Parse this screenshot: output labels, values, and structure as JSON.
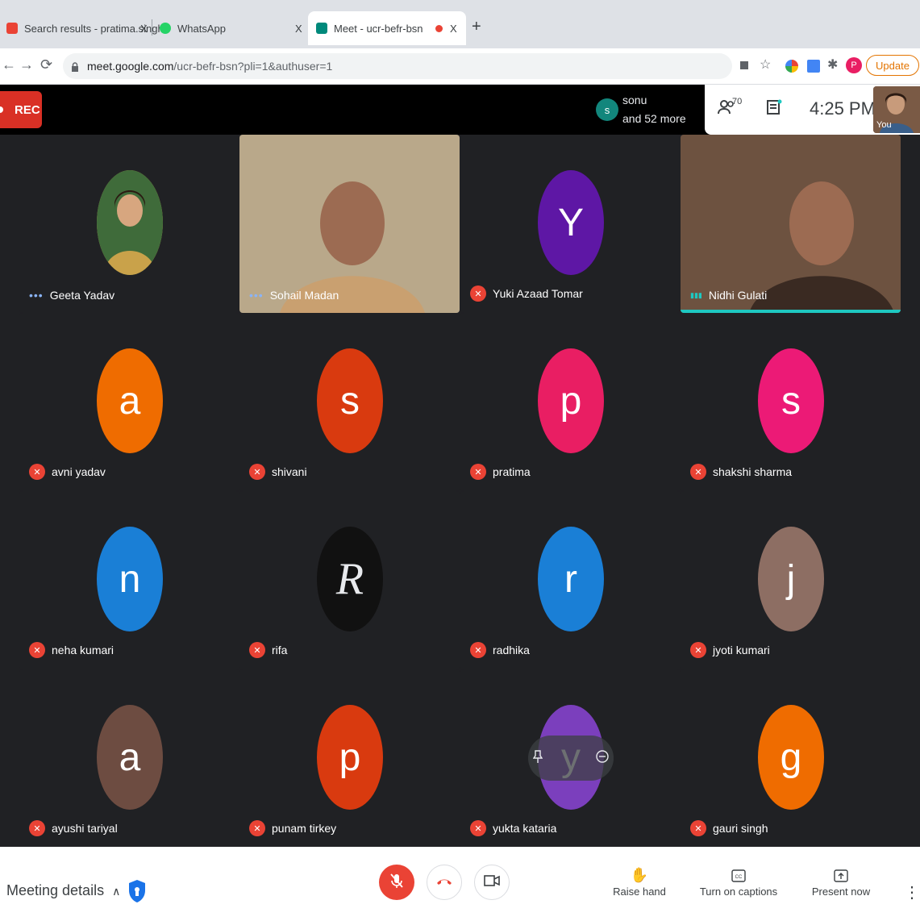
{
  "browser": {
    "tabs": [
      {
        "title": "Search results - pratima.singh",
        "close": "X",
        "favicon_color": "#ea4335"
      },
      {
        "title": "WhatsApp",
        "close": "X",
        "favicon_color": "#25d366"
      },
      {
        "title": "Meet - ucr-befr-bsn",
        "close": "X",
        "favicon_color": "#00897b"
      }
    ],
    "new_tab": "+",
    "url_host": "meet.google.com",
    "url_path": "/ucr-befr-bsn?pli=1&authuser=1",
    "update_label": "Update",
    "profile_initial": "P"
  },
  "meet": {
    "rec_label": "REC",
    "presenter": {
      "initial": "s",
      "name": "sonu",
      "more": "and 52 more"
    },
    "people_count": "70",
    "time": "4:25 PM",
    "self_label": "You",
    "tiles": [
      {
        "name": "Geeta Yadav",
        "type": "photo",
        "status": "dots",
        "color": "#c9a24a"
      },
      {
        "name": "Sohail Madan",
        "type": "video",
        "status": "dots",
        "color": "#b9a88a"
      },
      {
        "name": "Yuki Azaad Tomar",
        "type": "letter",
        "letter": "Y",
        "status": "muted",
        "color": "#5e17a5"
      },
      {
        "name": "Nidhi Gulati",
        "type": "video",
        "status": "speaking",
        "color": "#6d5240"
      },
      {
        "name": "avni yadav",
        "type": "letter",
        "letter": "a",
        "status": "muted",
        "color": "#ef6c00"
      },
      {
        "name": "shivani",
        "type": "letter",
        "letter": "s",
        "status": "muted",
        "color": "#d93a0f"
      },
      {
        "name": "pratima",
        "type": "letter",
        "letter": "p",
        "status": "muted",
        "color": "#e91e63"
      },
      {
        "name": "shakshi sharma",
        "type": "letter",
        "letter": "s",
        "status": "muted",
        "color": "#ec1a76"
      },
      {
        "name": "neha kumari",
        "type": "letter",
        "letter": "n",
        "status": "muted",
        "color": "#1a7fd6"
      },
      {
        "name": "rifa",
        "type": "logo",
        "letter": "R",
        "status": "muted",
        "color": "#111111"
      },
      {
        "name": "radhika",
        "type": "letter",
        "letter": "r",
        "status": "muted",
        "color": "#1a7fd6"
      },
      {
        "name": "jyoti kumari",
        "type": "letter",
        "letter": "j",
        "status": "muted",
        "color": "#8d6e63"
      },
      {
        "name": "ayushi tariyal",
        "type": "letter",
        "letter": "a",
        "status": "muted",
        "color": "#6d4c41"
      },
      {
        "name": "punam tirkey",
        "type": "letter",
        "letter": "p",
        "status": "muted",
        "color": "#d93a0f"
      },
      {
        "name": "yukta kataria",
        "type": "letter",
        "letter": "y",
        "status": "muted",
        "color": "#7b3fbd"
      },
      {
        "name": "gauri singh",
        "type": "letter",
        "letter": "g",
        "status": "muted",
        "color": "#ef6c00"
      }
    ]
  },
  "bottom": {
    "meeting_details": "Meeting details",
    "raise_hand": "Raise hand",
    "captions": "Turn on captions",
    "present": "Present now"
  },
  "colors": {
    "accent": "#1a73e8",
    "danger": "#ea4335",
    "speaking_bar": "#1ec8c1"
  }
}
